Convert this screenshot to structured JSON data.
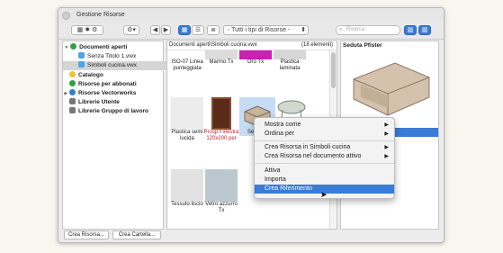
{
  "window": {
    "title": "Gestione Risorse"
  },
  "toolbar": {
    "filter_label": "- Tutti i tipi di Risorse -",
    "search_placeholder": "Ricerca"
  },
  "sidebar": {
    "items": [
      {
        "label": "Documenti aperti"
      },
      {
        "label": "Senza Titolo 1.vwx"
      },
      {
        "label": "Simboli cucina.vwx"
      },
      {
        "label": "Catalogo"
      },
      {
        "label": "Risorse per abbonati"
      },
      {
        "label": "Risorse Vectorworks"
      },
      {
        "label": "Librerie Utente"
      },
      {
        "label": "Librerie Gruppo di lavoro"
      }
    ]
  },
  "browser": {
    "path": "Documenti aperti\\Simboli cucina.vwx",
    "count": "(18 elementi)",
    "items": [
      {
        "label": "ISO-07 Linea punteggiata"
      },
      {
        "label": "Marmo Tx"
      },
      {
        "label": "Oro Tx"
      },
      {
        "label": "Plastica laminata"
      },
      {
        "label": "Plastica semi lucida"
      },
      {
        "label": "Prosp Finestra 120x200 per"
      },
      {
        "label": "Sed Pfis"
      },
      {
        "label": ""
      },
      {
        "label": "Tessuto liscio"
      },
      {
        "label": "Vetro azzurro Tx"
      }
    ]
  },
  "preview": {
    "title": "Seduta Pfister"
  },
  "buttons": {
    "new_resource": "Crea Risorsa...",
    "new_folder": "Crea Cartella..."
  },
  "context_menu": {
    "items": [
      {
        "label": "Mostra come"
      },
      {
        "label": "Ordina per"
      },
      {
        "label": "Crea Risorsa in Simboli cucina"
      },
      {
        "label": "Crea Risorsa nel documento attivo"
      },
      {
        "label": "Attiva"
      },
      {
        "label": "Importa"
      },
      {
        "label": "Crea Riferimento"
      }
    ]
  },
  "colors": {
    "accent": "#3a7bd5",
    "warning_text": "#c3202e"
  }
}
